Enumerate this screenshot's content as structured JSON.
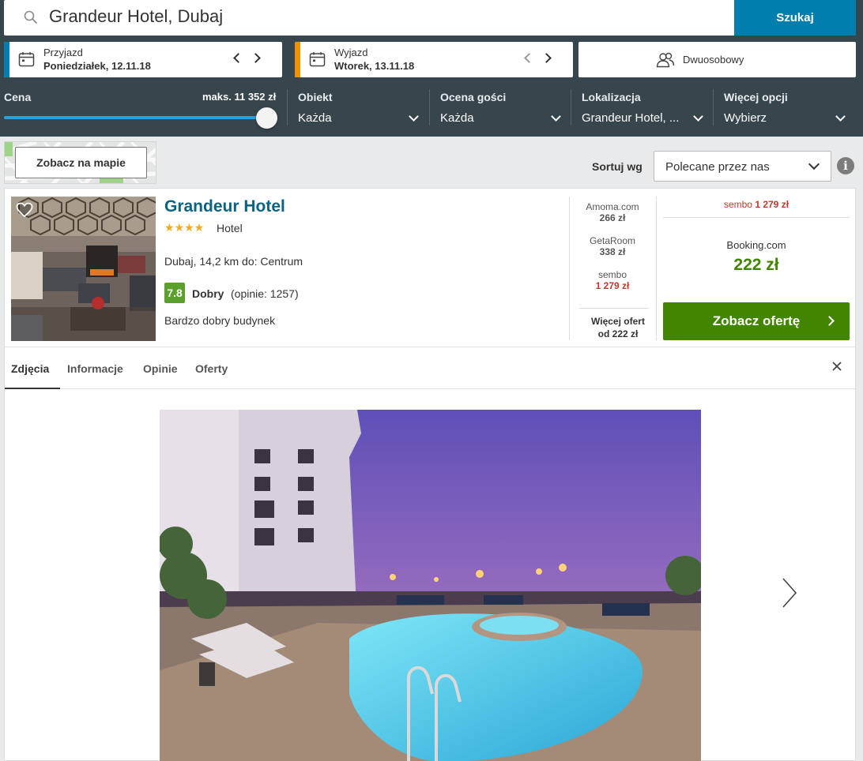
{
  "search": {
    "query": "Grandeur Hotel, Dubaj",
    "button_label": "Szukaj"
  },
  "dates": {
    "checkin": {
      "label": "Przyjazd",
      "value": "Poniedziałek, 12.11.18",
      "accent": "#007faf"
    },
    "checkout": {
      "label": "Wyjazd",
      "value": "Wtorek, 13.11.18",
      "accent": "#f39000"
    }
  },
  "room": {
    "label": "Dwuosobowy"
  },
  "filters": {
    "price": {
      "label": "Cena",
      "max_label": "maks. 11 352 zł",
      "slider_value": 1.0
    },
    "property": {
      "label": "Obiekt",
      "value": "Każda"
    },
    "rating": {
      "label": "Ocena gości",
      "value": "Każda"
    },
    "location": {
      "label": "Lokalizacja",
      "value": "Grandeur Hotel, ..."
    },
    "more": {
      "label": "Więcej opcji",
      "value": "Wybierz"
    }
  },
  "map": {
    "button_label": "Zobacz na mapie"
  },
  "sort": {
    "label": "Sortuj wg",
    "value": "Polecane przez nas"
  },
  "hotel": {
    "name": "Grandeur Hotel",
    "stars": "★★★★",
    "type": "Hotel",
    "location": "Dubaj, 14,2 km do: Centrum",
    "rating_score": "7.8",
    "rating_word": "Dobry",
    "rating_count": "(opinie: 1257)",
    "description": "Bardzo dobry budynek"
  },
  "deals": [
    {
      "provider": "Amoma.com",
      "price": "266 zł",
      "highlight": false
    },
    {
      "provider": "GetaRoom",
      "price": "338 zł",
      "highlight": false
    },
    {
      "provider": "sembo",
      "price": "1 279 zł",
      "highlight": true
    }
  ],
  "more_offers": {
    "line1": "Więcej ofert",
    "line2": "od 222 zł"
  },
  "top_deal": {
    "provider": "sembo",
    "price": "1 279 zł"
  },
  "best_deal": {
    "provider": "Booking.com",
    "price": "222 zł",
    "button_label": "Zobacz ofertę"
  },
  "tabs": [
    {
      "label": "Zdjęcia",
      "active": true
    },
    {
      "label": "Informacje",
      "active": false
    },
    {
      "label": "Opinie",
      "active": false
    },
    {
      "label": "Oferty",
      "active": false
    }
  ],
  "colors": {
    "header_bg": "#37454d",
    "search_blue": "#007faf",
    "deal_green": "#428500",
    "rating_green": "#5b9f2c",
    "price_red": "#c0392b",
    "name_blue": "#0a6380"
  }
}
